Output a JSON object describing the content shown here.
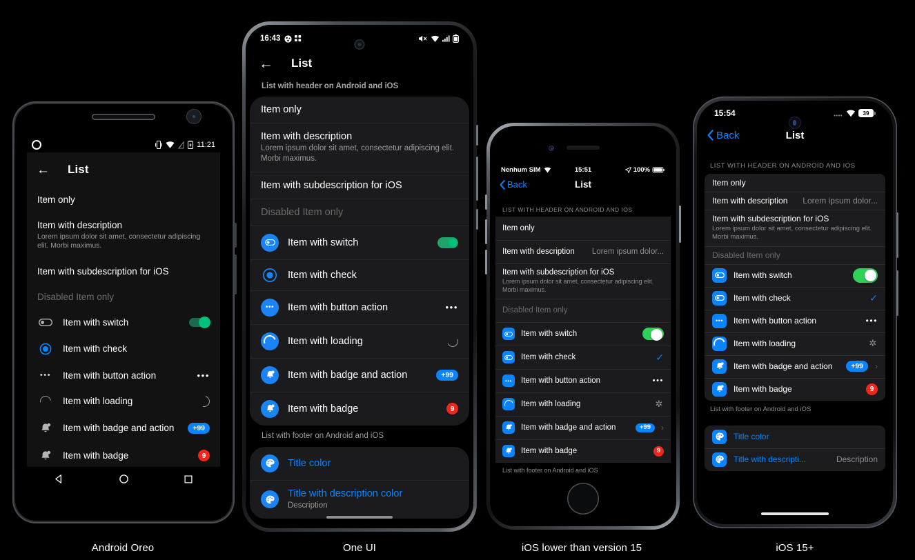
{
  "page": {
    "background": "#000000",
    "accent_blue": "#0a84ff",
    "accent_red": "#f0261d",
    "accent_green": "#30d158"
  },
  "captions": {
    "android_oreo": "Android Oreo",
    "one_ui": "One UI",
    "ios_lower": "iOS lower than version 15",
    "ios15": "iOS 15+"
  },
  "shared": {
    "screen_title": "List",
    "back_label": "Back",
    "header_android_ios": "List with header on Android and iOS",
    "header_android_ios_caps": "LIST WITH HEADER ON ANDROID AND IOS",
    "footer_android_ios": "List with footer on Android and iOS",
    "item_only": "Item only",
    "item_with_description": "Item with description",
    "description_text": "Lorem ipsum dolor sit amet, consectetur adipiscing elit. Morbi maximus.",
    "description_truncated": "Lorem ipsum dolor...",
    "item_with_subdescription": "Item with subdescription for iOS",
    "disabled_item_only": "Disabled Item only",
    "item_with_switch": "Item with switch",
    "item_with_check": "Item with check",
    "item_with_button_action": "Item with button action",
    "item_with_loading": "Item with loading",
    "item_with_badge_and_action": "Item with badge and action",
    "item_with_badge": "Item with badge",
    "badge_plus99": "+99",
    "badge_9": "9",
    "title_color": "Title color",
    "title_with_description_color": "Title with description color",
    "title_with_description_color_truncated": "Title with descripti...",
    "description_label": "Description"
  },
  "android_oreo": {
    "status": {
      "time": "11:21",
      "icons": [
        "vibrate-icon",
        "wifi-icon",
        "signal-off-icon",
        "battery-charging-icon"
      ]
    },
    "appbar": {
      "back_icon": "arrow-left-icon",
      "title": "List"
    },
    "nav": {
      "back": "triangle-back-icon",
      "home": "circle-home-icon",
      "recents": "square-recents-icon"
    }
  },
  "one_ui": {
    "status": {
      "time": "16:43",
      "left_icons": [
        "app-dot-icon",
        "grid-dots-icon"
      ],
      "right_icons": [
        "mute-icon",
        "wifi-icon",
        "signal-icon",
        "battery-icon"
      ]
    },
    "appbar": {
      "back_icon": "arrow-left-icon",
      "title": "List"
    }
  },
  "ios_lower": {
    "status": {
      "carrier": "Nenhum SIM",
      "wifi": "wifi-icon",
      "time": "15:51",
      "location": "location-arrow-icon",
      "battery_percent": "100%",
      "battery": "battery-full-icon"
    },
    "navbar": {
      "back_icon": "chevron-left-icon",
      "back_label": "Back",
      "title": "List"
    }
  },
  "ios15": {
    "status": {
      "time": "15:54",
      "signal": "signal-icon",
      "wifi": "wifi-icon",
      "battery_level": "39"
    },
    "navbar": {
      "back_icon": "chevron-left-icon",
      "back_label": "Back",
      "title": "List"
    }
  }
}
